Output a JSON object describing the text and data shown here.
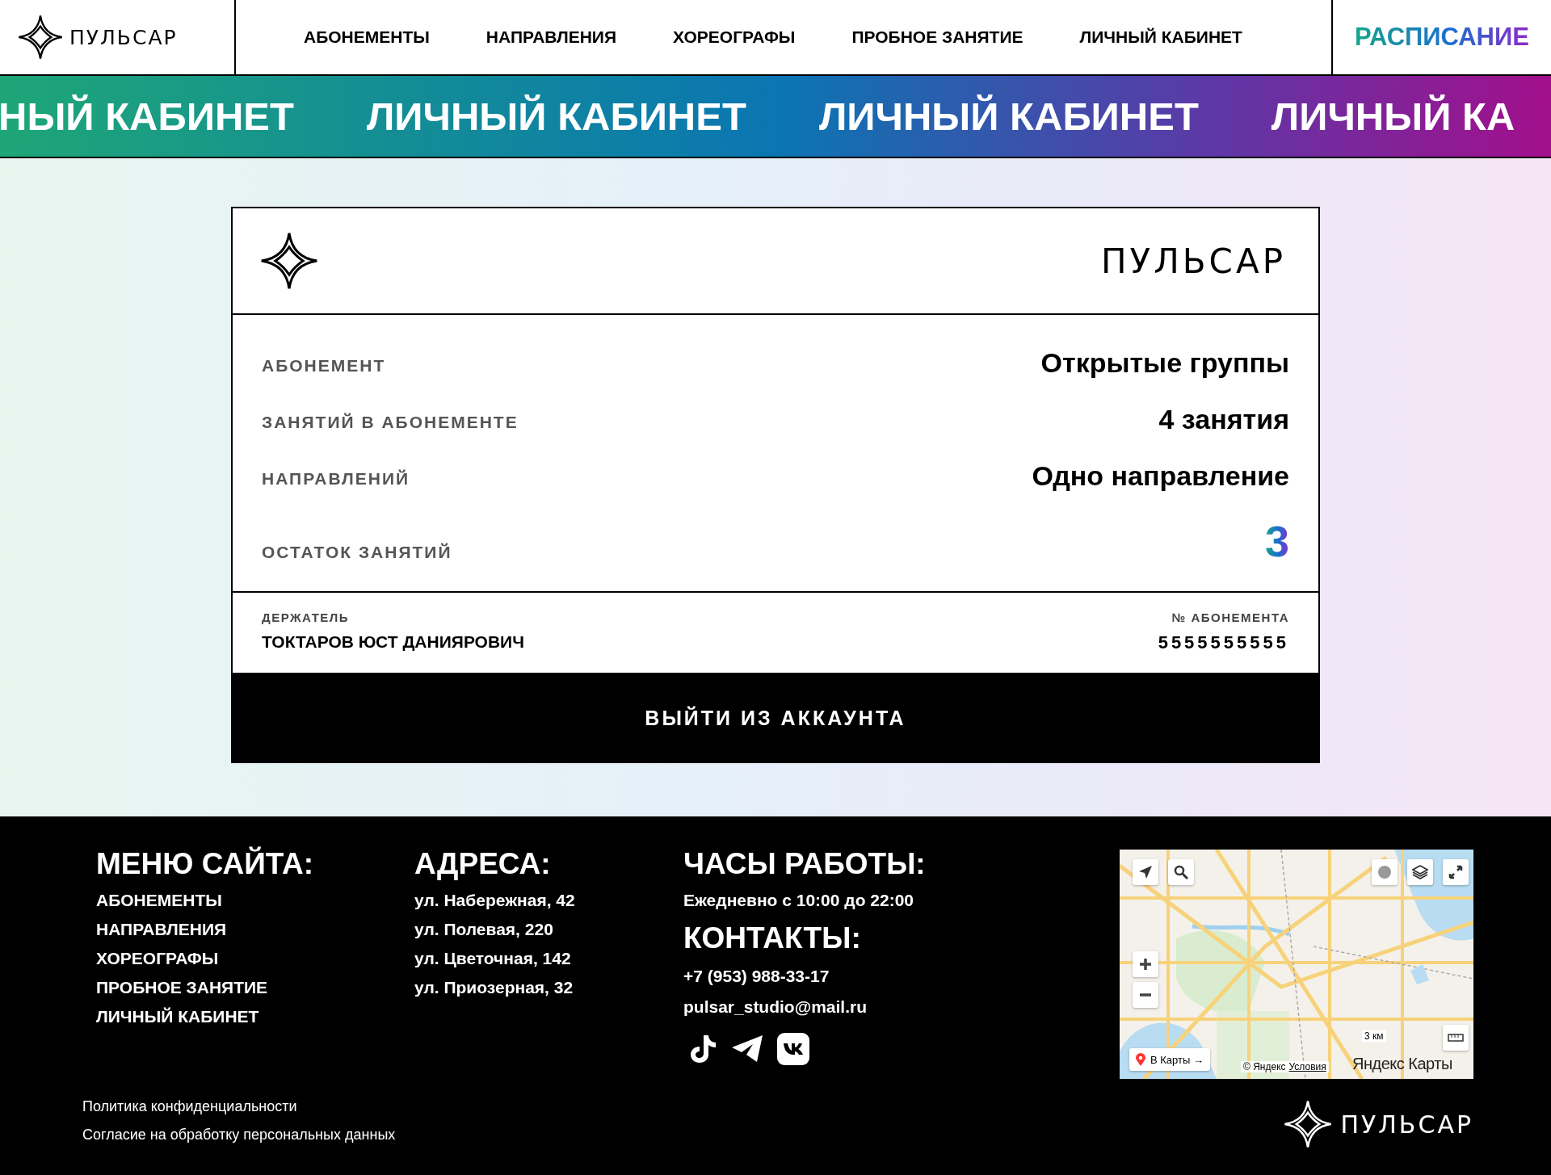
{
  "header": {
    "logo": "ПУЛЬСАР",
    "nav": [
      "АБОНЕМЕНТЫ",
      "НАПРАВЛЕНИЯ",
      "ХОРЕОГРАФЫ",
      "ПРОБНОЕ ЗАНЯТИЕ",
      "ЛИЧНЫЙ КАБИНЕТ"
    ],
    "cta": "РАСПИСАНИЕ"
  },
  "marquee": [
    "НЫЙ КАБИНЕТ",
    "ЛИЧНЫЙ КАБИНЕТ",
    "ЛИЧНЫЙ КАБИНЕТ",
    "ЛИЧНЫЙ КА"
  ],
  "card": {
    "logo": "ПУЛЬСАР",
    "rows": [
      {
        "label": "АБОНЕМЕНТ",
        "value": "Открытые группы",
        "kind": "text"
      },
      {
        "label": "ЗАНЯТИЙ В АБОНЕМЕНТЕ",
        "value": "4 занятия",
        "kind": "text"
      },
      {
        "label": "НАПРАВЛЕНИЙ",
        "value": "Одно направление",
        "kind": "text"
      },
      {
        "label": "ОСТАТОК ЗАНЯТИЙ",
        "value": "3",
        "kind": "highlight"
      }
    ],
    "holder": {
      "label": "ДЕРЖАТЕЛЬ",
      "value": "ТОКТАРОВ ЮСТ ДАНИЯРОВИЧ"
    },
    "number": {
      "label": "№ АБОНЕМЕНТА",
      "value": "5555555555"
    },
    "logout": "ВЫЙТИ ИЗ АККАУНТА"
  },
  "footer": {
    "menu": {
      "title": "МЕНЮ САЙТА:",
      "items": [
        "АБОНЕМЕНТЫ",
        "НАПРАВЛЕНИЯ",
        "ХОРЕОГРАФЫ",
        "ПРОБНОЕ ЗАНЯТИЕ",
        "ЛИЧНЫЙ КАБИНЕТ"
      ]
    },
    "addresses": {
      "title": "АДРЕСА:",
      "items": [
        "ул. Набережная, 42",
        "ул. Полевая, 220",
        "ул. Цветочная, 142",
        "ул. Приозерная, 32"
      ]
    },
    "hours": {
      "title": "ЧАСЫ РАБОТЫ:",
      "text": "Ежедневно с 10:00 до 22:00"
    },
    "contacts": {
      "title": "КОНТАКТЫ:",
      "phone": "+7 (953) 988-33-17",
      "email": "pulsar_studio@mail.ru"
    },
    "map": {
      "kind": "picture",
      "open_button": "В Карты →",
      "scale": "3 км",
      "copyright": "© Яндекс",
      "terms": "Условия",
      "brand": "Яндекс Карты"
    },
    "legal": [
      "Политика конфиденциальности",
      "Согласие на обработку персональных данных"
    ],
    "logo": "ПУЛЬСАР"
  }
}
